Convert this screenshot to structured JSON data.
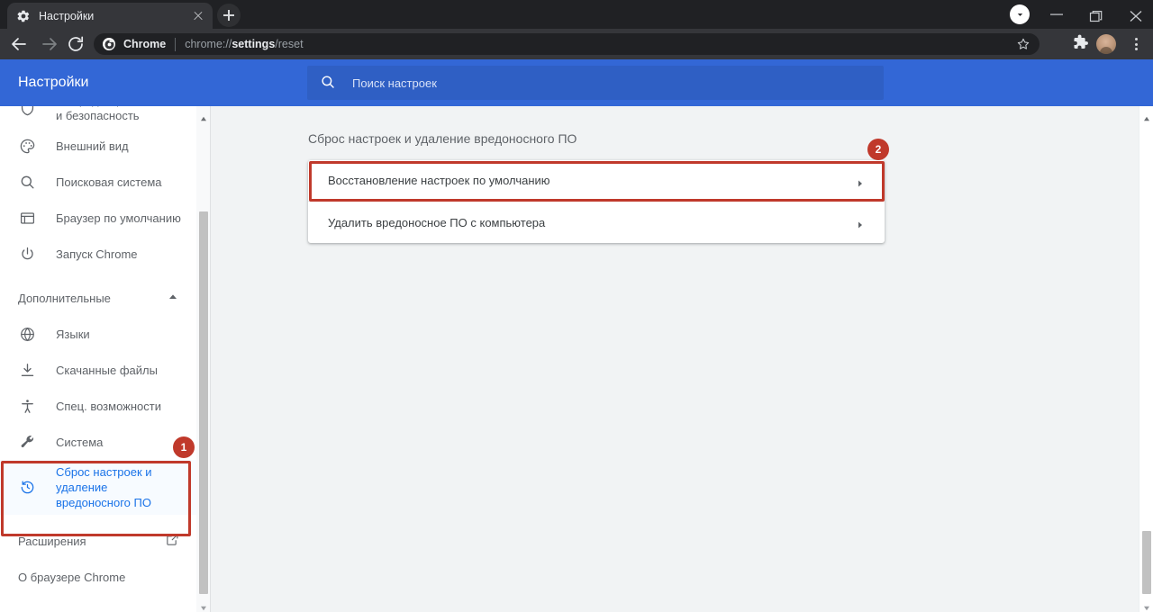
{
  "browser": {
    "tab": {
      "title": "Настройки",
      "favicon": "gear-icon",
      "close": "close-icon"
    },
    "new_tab_label": "+",
    "window_controls": {
      "download": "download-indicator-icon",
      "minimize": "minimize-icon",
      "maximize": "maximize-icon",
      "close": "window-close-icon"
    },
    "nav": {
      "back": "back-arrow-icon",
      "forward": "forward-arrow-icon",
      "reload": "reload-icon"
    },
    "omnibox": {
      "site_icon": "chrome-icon",
      "product": "Chrome",
      "url_prefix": "chrome://",
      "url_bold": "settings",
      "url_suffix": "/reset",
      "bookmark": "star-icon"
    },
    "toolbar_right": {
      "extensions": "puzzle-piece-icon",
      "profile": "avatar",
      "menu": "three-dot-menu-icon"
    }
  },
  "settings_header": {
    "title": "Настройки",
    "search": {
      "icon": "search-icon",
      "placeholder": "Поиск настроек",
      "value": ""
    }
  },
  "sidebar": {
    "items": [
      {
        "label": "Конфиденциальность и безопасность",
        "icon": "shield-icon",
        "active": false
      },
      {
        "label": "Внешний вид",
        "icon": "palette-icon",
        "active": false
      },
      {
        "label": "Поисковая система",
        "icon": "search-icon",
        "active": false
      },
      {
        "label": "Браузер по умолчанию",
        "icon": "browser-window-icon",
        "active": false
      },
      {
        "label": "Запуск Chrome",
        "icon": "power-icon",
        "active": false
      }
    ],
    "group": {
      "label": "Дополнительные",
      "expanded": true,
      "icon": "chevron-up-icon"
    },
    "advanced_items": [
      {
        "label": "Языки",
        "icon": "globe-icon",
        "active": false
      },
      {
        "label": "Скачанные файлы",
        "icon": "download-icon",
        "active": false
      },
      {
        "label": "Спец. возможности",
        "icon": "accessibility-icon",
        "active": false
      },
      {
        "label": "Система",
        "icon": "wrench-icon",
        "active": false
      },
      {
        "label": "Сброс настроек и удаление вредоносного ПО",
        "icon": "history-restore-icon",
        "active": true
      }
    ],
    "footer_items": [
      {
        "label": "Расширения",
        "icon": "external-link-icon"
      },
      {
        "label": "О браузере Chrome",
        "icon": ""
      }
    ],
    "scrollbar": {
      "up": "scroll-up-arrow",
      "down": "scroll-down-arrow"
    }
  },
  "main": {
    "section_title": "Сброс настроек и удаление вредоносного ПО",
    "rows": [
      {
        "label": "Восстановление настроек по умолчанию",
        "arrow": "chevron-right-icon"
      },
      {
        "label": "Удалить вредоносное ПО с компьютера",
        "arrow": "chevron-right-icon"
      }
    ],
    "scrollbar": {
      "up": "scroll-up-arrow",
      "down": "scroll-down-arrow"
    }
  },
  "annotations": {
    "badge_1": "1",
    "badge_2": "2",
    "color": "#c0392b"
  },
  "colors": {
    "titlebar": "#202124",
    "toolbar": "#35363a",
    "settings_header": "#3367d6",
    "search_box": "#2f5fc4",
    "page_background": "#f1f3f4",
    "card": "#ffffff",
    "accent_blue": "#1a73e8",
    "annotation_red": "#c0392b"
  }
}
